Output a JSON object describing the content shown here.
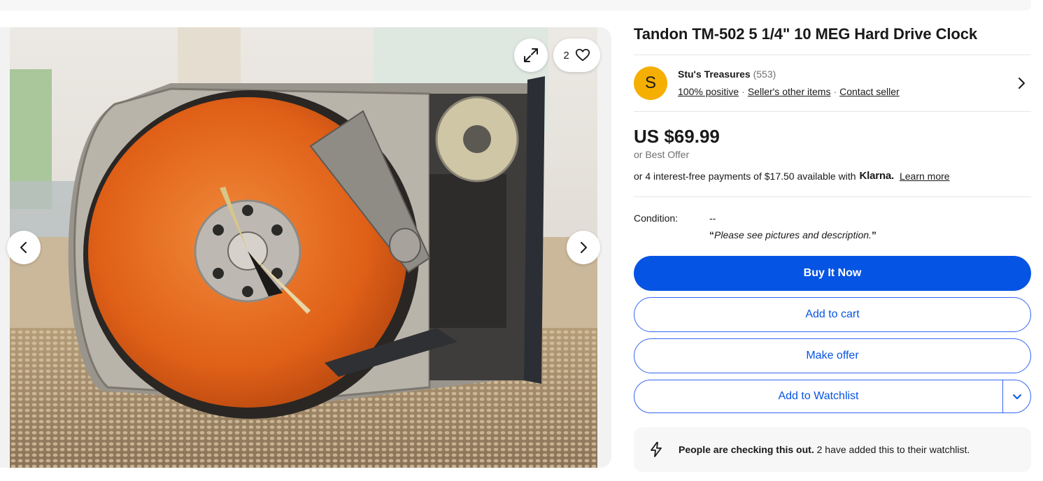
{
  "listing": {
    "title": "Tandon TM-502 5 1/4\" 10 MEG Hard Drive Clock",
    "watch_count": "2"
  },
  "seller": {
    "initial": "S",
    "name": "Stu's Treasures",
    "feedback_count": "(553)",
    "positive": "100% positive",
    "other_items": "Seller's other items",
    "contact": "Contact seller",
    "avatar_color": "#f5af02"
  },
  "price": {
    "amount": "US $69.99",
    "best_offer": "or Best Offer",
    "installments_prefix": "or 4 interest-free payments of $17.50 available with",
    "klarna": "Klarna.",
    "learn_more": "Learn more"
  },
  "condition": {
    "label": "Condition:",
    "value": "--",
    "quote_open": "“",
    "description": "Please see pictures and description.",
    "quote_close": "”"
  },
  "actions": {
    "buy_now": "Buy It Now",
    "add_to_cart": "Add to cart",
    "make_offer": "Make offer",
    "add_to_watchlist": "Add to Watchlist"
  },
  "alert": {
    "bold": "People are checking this out.",
    "rest": " 2 have added this to their watchlist."
  },
  "colors": {
    "primary": "#0654e3",
    "outline": "#3665f3",
    "platter": "#e86a1a"
  },
  "icons": {
    "expand": "expand-icon",
    "heart": "heart-icon",
    "prev": "chevron-left-icon",
    "next": "chevron-right-icon",
    "seller_chevron": "chevron-right-icon",
    "watch_dropdown": "chevron-down-icon",
    "alert": "lightning-icon"
  }
}
